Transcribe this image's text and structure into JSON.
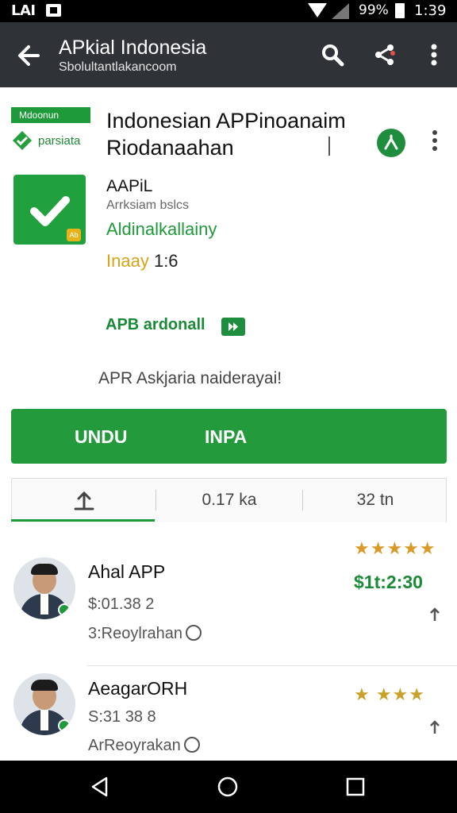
{
  "status_bar": {
    "carrier": "LAI",
    "battery": "99%",
    "time": "1:39"
  },
  "app_bar": {
    "title": "APkial Indonesia",
    "subtitle": "Sbolultantlakancoom",
    "back_icon": "arrow-left-icon",
    "search_icon": "search-icon",
    "share_icon": "share-icon",
    "menu_icon": "more-vert-icon"
  },
  "header": {
    "brand_band": "Mdoonun",
    "brand_word": "parsiata",
    "title_line1": "Indonesian APPinoanaim",
    "title_line2": "Riodanaahan"
  },
  "app_info": {
    "name": "AAPiL",
    "developer": "Arrksiam bslcs",
    "category": "Aldinalkallainy",
    "rating_prefix": "Inaay",
    "rating_value": "1:6",
    "badge": "Ab"
  },
  "developer_link": {
    "label": "APB ardonall"
  },
  "description": "APR Askjaria naiderayai!",
  "main_button": {
    "label_left": "UNDU",
    "label_right": "INPA"
  },
  "tabs": [
    {
      "label": ""
    },
    {
      "label": "0.17 ka"
    },
    {
      "label": "32 tn"
    }
  ],
  "reviews": [
    {
      "name": "Ahal APP",
      "price": "$:01.38 2",
      "sub": "3:Reoylrahan",
      "stars": "★★★★★",
      "amount": "$1t:2:30"
    },
    {
      "name": "AeagarORH",
      "price": "S:31 38 8",
      "sub": "ArReoyrakan",
      "stars": "★ ★★★",
      "amount": ""
    }
  ],
  "colors": {
    "accent": "#239a3c",
    "appbar": "#2f3337",
    "star": "#e0a020"
  }
}
